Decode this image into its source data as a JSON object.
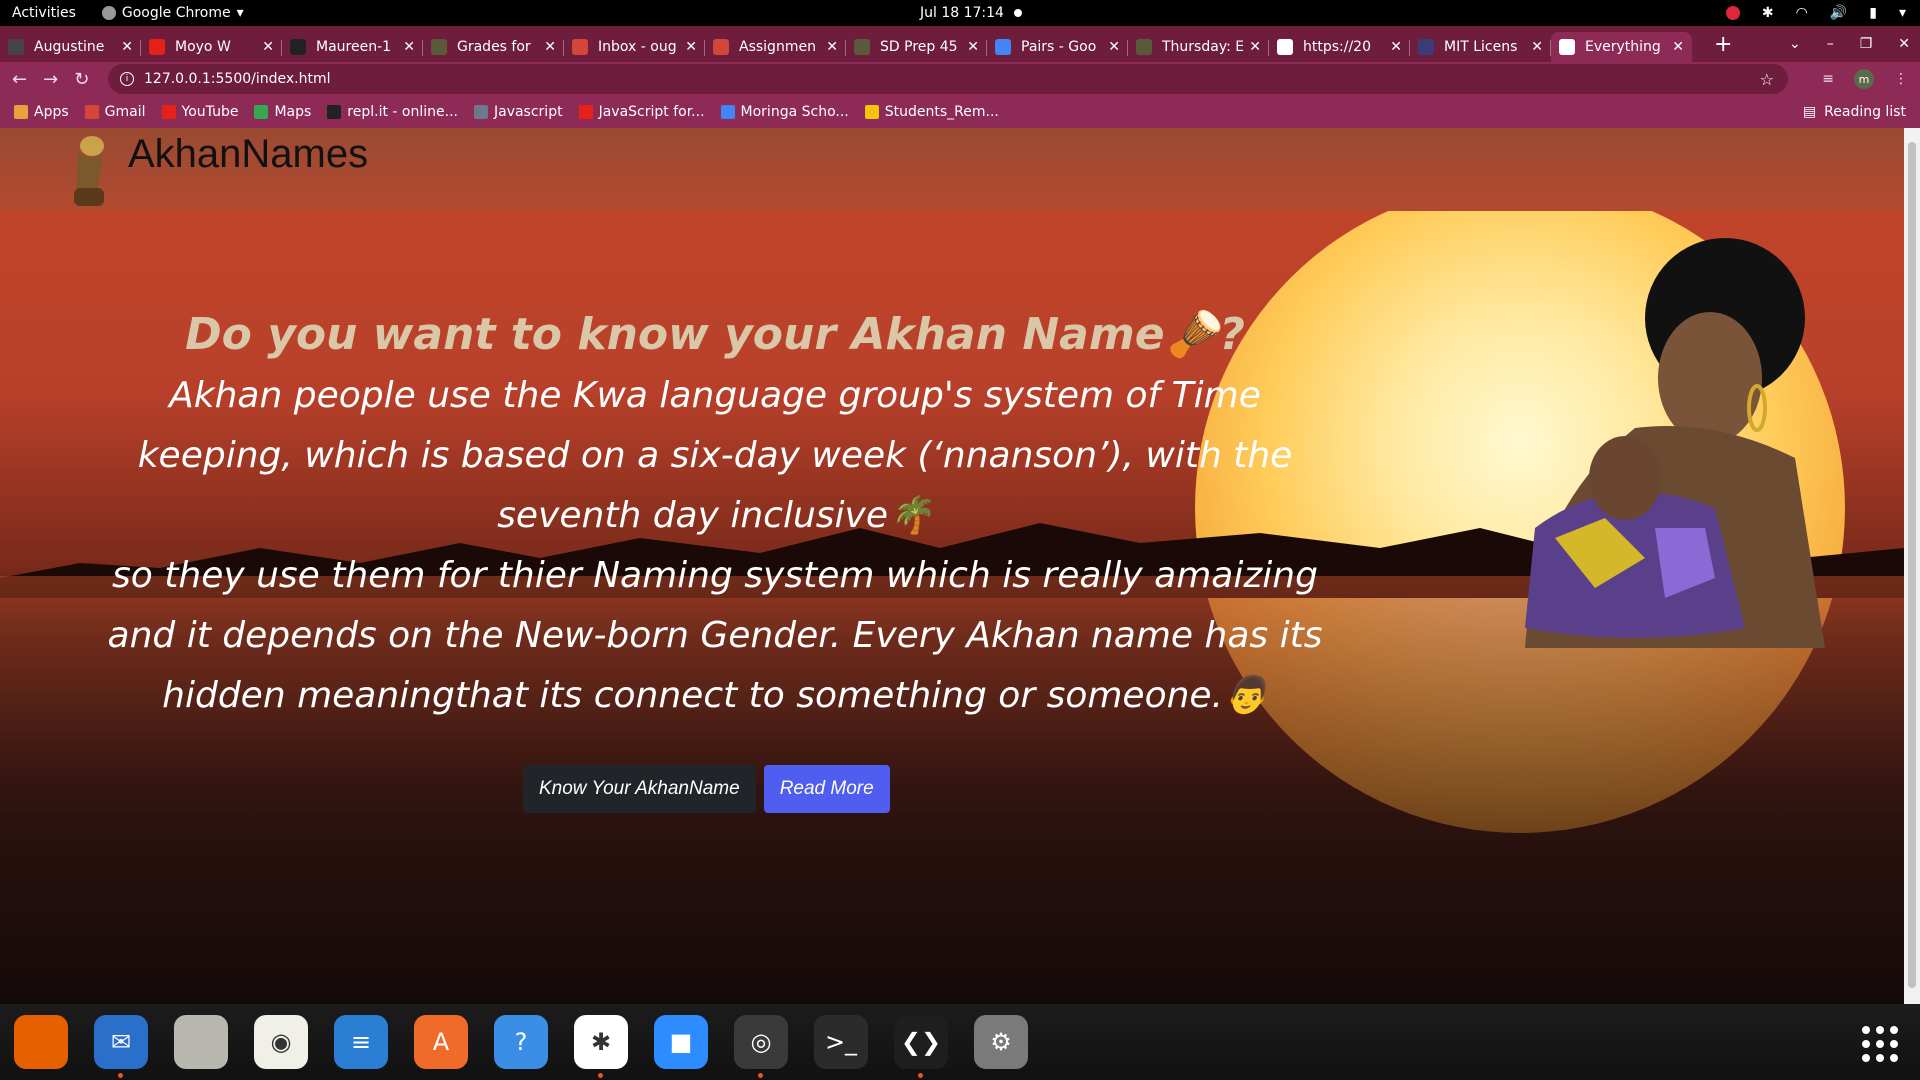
{
  "system_bar": {
    "activities": "Activities",
    "app_name": "Google Chrome",
    "clock": "Jul 18  17:14"
  },
  "tabs": [
    {
      "title": "Augustine",
      "fav": "#444",
      "active": false
    },
    {
      "title": "Moyo W",
      "fav": "#e62117",
      "active": false
    },
    {
      "title": "Maureen-1",
      "fav": "#222",
      "active": false
    },
    {
      "title": "Grades for",
      "fav": "#5a5a3a",
      "active": false
    },
    {
      "title": "Inbox - oug",
      "fav": "#d44638",
      "active": false
    },
    {
      "title": "Assignmen",
      "fav": "#d44638",
      "active": false
    },
    {
      "title": "SD Prep 45",
      "fav": "#5a5a3a",
      "active": false
    },
    {
      "title": "Pairs - Goo",
      "fav": "#4285f4",
      "active": false
    },
    {
      "title": "Thursday: E",
      "fav": "#5a5a3a",
      "active": false
    },
    {
      "title": "https://20",
      "fav": "#ffffff",
      "active": false
    },
    {
      "title": "MIT Licens",
      "fav": "#3b3b7a",
      "active": false
    },
    {
      "title": "Everything",
      "fav": "#ffffff",
      "active": true
    }
  ],
  "toolbar": {
    "url": "127.0.0.1:5500/index.html",
    "profile_initial": "m"
  },
  "bookmarks": [
    {
      "label": "Apps",
      "color": "#e8a33d"
    },
    {
      "label": "Gmail",
      "color": "#d44638"
    },
    {
      "label": "YouTube",
      "color": "#e62117"
    },
    {
      "label": "Maps",
      "color": "#34a853"
    },
    {
      "label": "repl.it - online...",
      "color": "#222"
    },
    {
      "label": "Javascript",
      "color": "#6a7a8a"
    },
    {
      "label": "JavaScript for...",
      "color": "#e62117"
    },
    {
      "label": "Moringa Scho...",
      "color": "#4285f4"
    },
    {
      "label": "Students_Rem...",
      "color": "#f4c20d"
    }
  ],
  "reading_list": "Reading list",
  "site": {
    "brand": "AkhanNames",
    "heading": "Do you want to know your Akhan Name🪘?",
    "paragraph_1": "Akhan people use the Kwa language group's system of Time keeping, which is based on a six-day week (‘nnanson’), with the seventh day inclusive🌴",
    "paragraph_2": "so they use them for thier Naming system which is really amaizing and it depends on the New-born Gender. Every Akhan name has its hidden meaningthat its connect to something or someone.👨",
    "btn_know": "Know Your AkhanName",
    "btn_read": "Read More"
  },
  "dock": [
    {
      "name": "firefox-icon",
      "color": "#e66000",
      "glyph": "",
      "running": false
    },
    {
      "name": "thunderbird-icon",
      "color": "#2a6fc9",
      "glyph": "✉",
      "running": true
    },
    {
      "name": "files-icon",
      "color": "#b8b8b0",
      "glyph": "",
      "running": false
    },
    {
      "name": "rhythmbox-icon",
      "color": "#f0f0e8",
      "glyph": "◉",
      "running": false
    },
    {
      "name": "writer-icon",
      "color": "#2a7fd4",
      "glyph": "≡",
      "running": false
    },
    {
      "name": "software-center-icon",
      "color": "#f06a2a",
      "glyph": "A",
      "running": false
    },
    {
      "name": "help-icon",
      "color": "#3a8ee6",
      "glyph": "?",
      "running": false
    },
    {
      "name": "slack-icon",
      "color": "#ffffff",
      "glyph": "✱",
      "running": true
    },
    {
      "name": "zoom-icon",
      "color": "#2d8cff",
      "glyph": "■",
      "running": false
    },
    {
      "name": "chrome-icon",
      "color": "#3a3a3a",
      "glyph": "◎",
      "running": true
    },
    {
      "name": "terminal-icon",
      "color": "#2b2b2b",
      "glyph": ">_",
      "running": false
    },
    {
      "name": "vscode-icon",
      "color": "#1e1e1e",
      "glyph": "❮❯",
      "running": true
    },
    {
      "name": "settings-icon",
      "color": "#7a7a7a",
      "glyph": "⚙",
      "running": false
    }
  ]
}
